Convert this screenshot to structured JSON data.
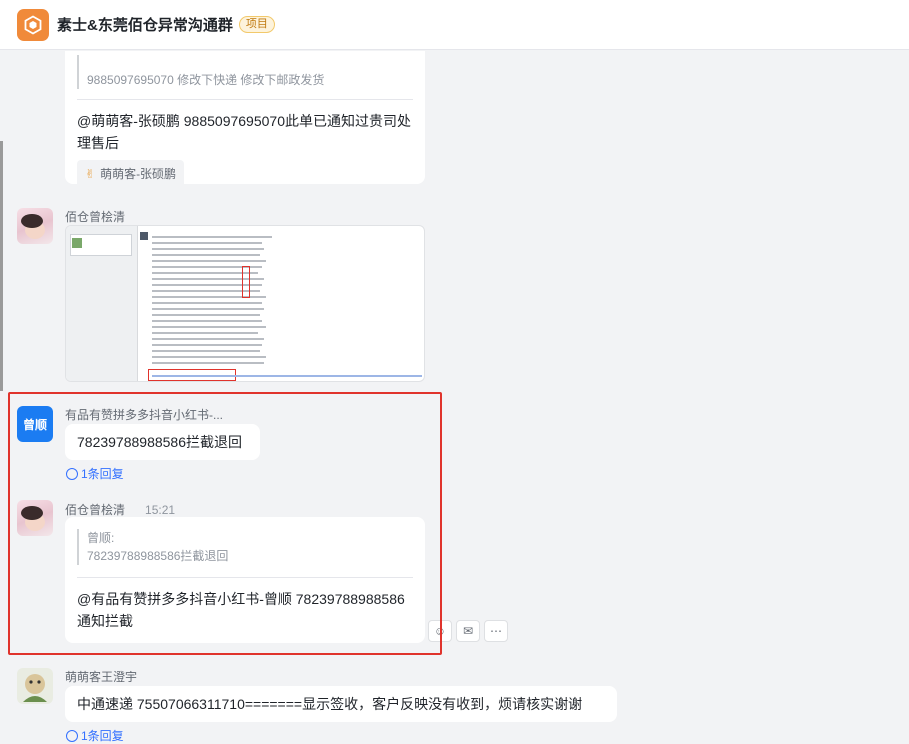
{
  "header": {
    "group_name": "素士&东莞佰仓异常沟通群",
    "tag": "项目"
  },
  "messages": {
    "m1": {
      "quote_line": "9885097695070  修改下快递 修改下邮政发货",
      "text": "@萌萌客-张硕鹏 9885097695070此单已通知过贵司处理售后",
      "reaction_user": "萌萌客-张硕鹏"
    },
    "m2": {
      "sender": "佰仓曾桧清"
    },
    "m3": {
      "sender": "有品有赞拼多多抖音小红书-...",
      "avatar_text": "曾顺",
      "text": "78239788988586拦截退回",
      "reply_count": "1条回复"
    },
    "m4": {
      "sender": "佰仓曾桧清",
      "time": "15:21",
      "quote_name": "曾顺:",
      "quote_text": "78239788988586拦截退回",
      "text": "@有品有赞拼多多抖音小红书-曾顺 78239788988586通知拦截"
    },
    "m5": {
      "sender": "萌萌客王澄宇",
      "text": "中通速递 75507066311710=======显示签收，客户反映没有收到，烦请核实谢谢",
      "reply_count": "1条回复"
    }
  },
  "icons": {
    "group_avatar": "hexagon-logo-icon",
    "reaction": "ok-hand-icon",
    "reply": "reply-bubble-icon",
    "emoji_tool": "emoji-icon",
    "reply_tool": "comment-icon",
    "more_tool": "more-icon"
  },
  "colors": {
    "accent": "#3370ff",
    "highlight": "#e0332c",
    "group_avatar": "#f08a3a",
    "brand_avatar": "#1b7cf2"
  }
}
